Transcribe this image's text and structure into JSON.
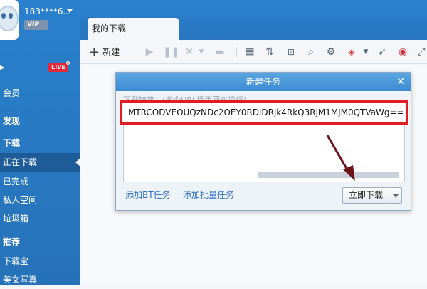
{
  "user": {
    "name": "183****6...",
    "vip_label": "VIP"
  },
  "sidebar": {
    "live_label": "LIVE",
    "items": [
      {
        "label": "会员"
      },
      {
        "label": "发现"
      },
      {
        "label": "下载"
      },
      {
        "label": "正在下载"
      },
      {
        "label": "已完成"
      },
      {
        "label": "私人空间"
      },
      {
        "label": "垃圾箱"
      },
      {
        "label": "推荐"
      },
      {
        "label": "下载宝"
      },
      {
        "label": "美女写真"
      }
    ]
  },
  "tabs": {
    "my_downloads": "我的下载"
  },
  "toolbar": {
    "new_label": "新建",
    "icons": [
      "play-icon",
      "pause-icon",
      "delete-icon",
      "folder-icon",
      "grid-icon",
      "sort-icon",
      "details-icon",
      "search-icon",
      "settings-icon",
      "vip-icon",
      "speed-icon",
      "shield-icon",
      "expand-icon"
    ]
  },
  "dialog": {
    "title": "新建任务",
    "close": "✕",
    "url_label": "下载链接：(多个URL请用回车换行)",
    "url_value": "MTRCODVEOUQzNDc2OEY0RDlDRjk4RkQ3RjM1MjM0QTVaWg==",
    "add_bt_label": "添加BT任务",
    "add_batch_label": "添加批量任务",
    "download_now_label": "立即下载"
  },
  "colors": {
    "accent_red": "#e31b23",
    "link_blue": "#2a6fc5"
  }
}
